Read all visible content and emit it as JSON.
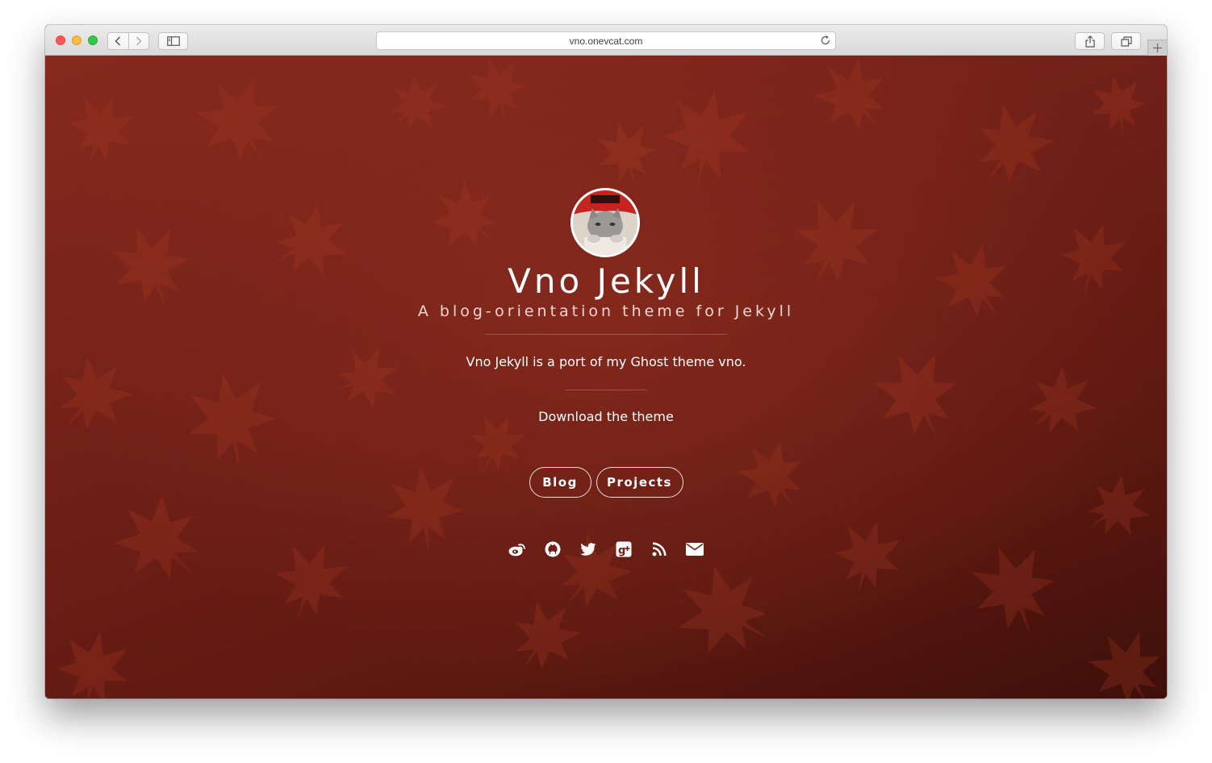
{
  "browser": {
    "url": "vno.onevcat.com",
    "buttons": [
      "back-icon",
      "forward-icon",
      "sidebar-icon",
      "share-icon",
      "tabs-icon",
      "new-tab-icon",
      "reload-icon"
    ]
  },
  "site": {
    "title": "Vno Jekyll",
    "subtitle": "A blog-orientation theme for Jekyll",
    "description": "Vno Jekyll is a port of my Ghost theme vno.",
    "download_label": "Download the theme",
    "nav": [
      {
        "label": "Blog"
      },
      {
        "label": "Projects"
      }
    ],
    "social_icons": [
      "weibo-icon",
      "github-icon",
      "twitter-icon",
      "google-plus-icon",
      "rss-icon",
      "email-icon"
    ]
  },
  "colors": {
    "background": "#6e1f16",
    "text": "#ffffff",
    "subtitle": "#efd6d0"
  }
}
